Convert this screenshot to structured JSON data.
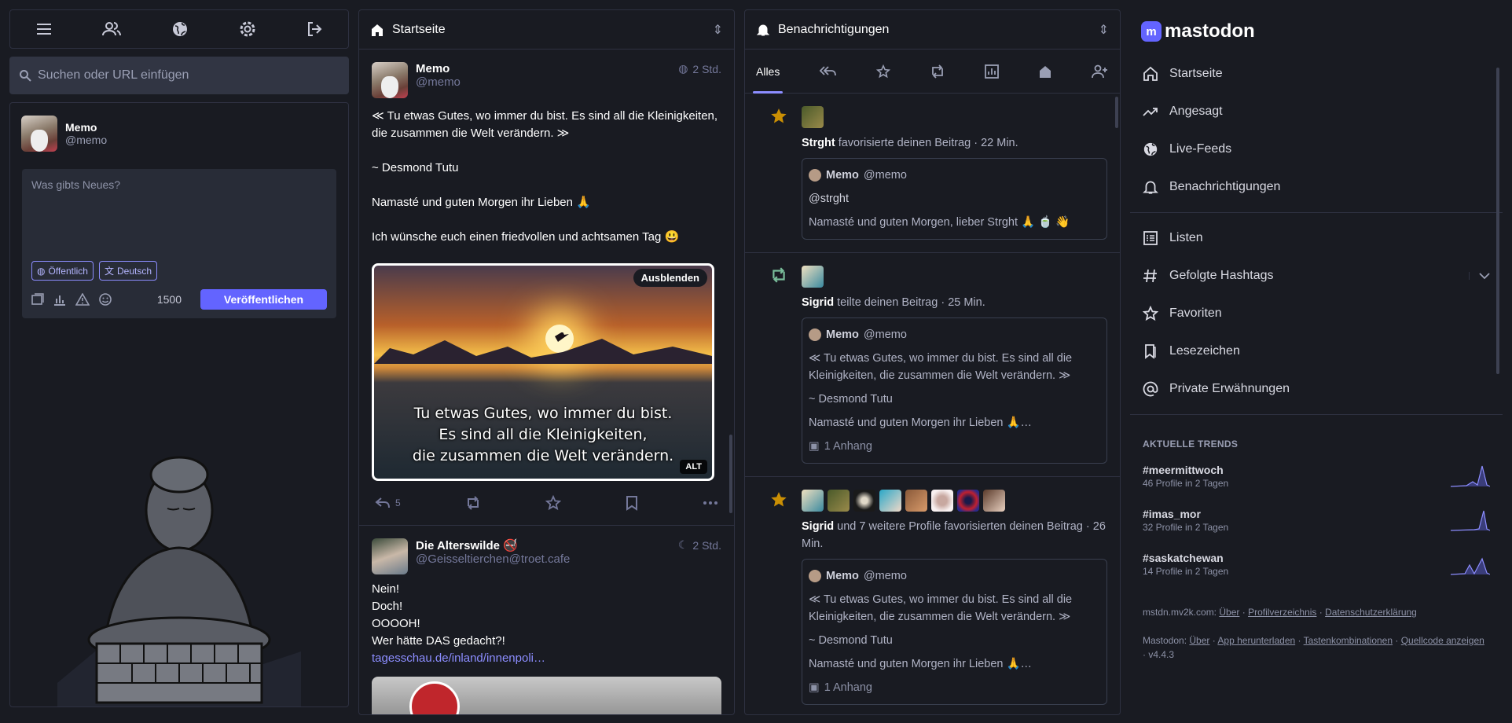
{
  "search": {
    "placeholder": "Suchen oder URL einfügen"
  },
  "me": {
    "name": "Memo",
    "handle": "@memo"
  },
  "compose": {
    "placeholder": "Was gibts Neues?",
    "visibility": "Öffentlich",
    "language": "Deutsch",
    "count": "1500",
    "publish": "Veröffentlichen"
  },
  "home": {
    "title": "Startseite",
    "post1": {
      "name": "Memo",
      "handle": "@memo",
      "time": "2 Std.",
      "p1": "≪ Tu etwas Gutes, wo immer du bist. Es sind all die Kleinigkeiten, die zusammen die Welt verändern. ≫",
      "p2": "~ Desmond Tutu",
      "p3": "Namasté und guten Morgen ihr Lieben 🙏",
      "p4": "Ich wünsche euch einen friedvollen und achtsamen Tag 😃",
      "img_line1": "Tu etwas Gutes, wo immer du bist.",
      "img_line2": "Es sind all die Kleinigkeiten,",
      "img_line3": "die zusammen die Welt verändern.",
      "hide": "Ausblenden",
      "alt": "ALT",
      "replies": "5"
    },
    "post2": {
      "name": "Die Alterswilde 🚭",
      "handle": "@Geisseltierchen@troet.cafe",
      "time": "2 Std.",
      "l1": "Nein!",
      "l2": "Doch!",
      "l3": "OOOOH!",
      "l4": "Wer hätte DAS gedacht?!",
      "link": "tagesschau.de/inland/innenpoli…"
    }
  },
  "notifs": {
    "title": "Benachrichtigungen",
    "tab_all": "Alles",
    "n1": {
      "who": "Strght",
      "action": "favorisierte deinen Beitrag",
      "time": "22 Min.",
      "qname": "Memo",
      "qhandle": "@memo",
      "q1": "@strght",
      "q2": "Namasté und guten Morgen, lieber Strght 🙏 🍵 👋"
    },
    "n2": {
      "who": "Sigrid",
      "action": "teilte deinen Beitrag",
      "time": "25 Min.",
      "qname": "Memo",
      "qhandle": "@memo",
      "q1": "≪ Tu etwas Gutes, wo immer du bist. Es sind all die Kleinigkeiten, die zusammen die Welt verändern. ≫",
      "q2": "~ Desmond Tutu",
      "q3": "Namasté und guten Morgen ihr Lieben 🙏…",
      "att": "1 Anhang"
    },
    "n3": {
      "who": "Sigrid",
      "action": "und 7 weitere Profile favorisierten deinen Beitrag",
      "time": "26 Min.",
      "qname": "Memo",
      "qhandle": "@memo",
      "q1": "≪ Tu etwas Gutes, wo immer du bist. Es sind all die Kleinigkeiten, die zusammen die Welt verändern. ≫",
      "q2": "~ Desmond Tutu",
      "q3": "Namasté und guten Morgen ihr Lieben 🙏…",
      "att": "1 Anhang"
    }
  },
  "side": {
    "logo": "mastodon",
    "nav": [
      "Startseite",
      "Angesagt",
      "Live-Feeds",
      "Benachrichtigungen",
      "Listen",
      "Gefolgte Hashtags",
      "Favoriten",
      "Lesezeichen",
      "Private Erwähnungen"
    ],
    "trends_title": "AKTUELLE TRENDS",
    "trends": [
      {
        "tag": "#meermittwoch",
        "meta": "46 Profile in 2 Tagen"
      },
      {
        "tag": "#imas_mor",
        "meta": "32 Profile in 2 Tagen"
      },
      {
        "tag": "#saskatchewan",
        "meta": "14 Profile in 2 Tagen"
      }
    ],
    "foot1_server": "mstdn.mv2k.com:",
    "foot1_links": [
      "Über",
      "Profilverzeichnis",
      "Datenschutzerklärung"
    ],
    "foot2_app": "Mastodon:",
    "foot2_links": [
      "Über",
      "App herunterladen",
      "Tastenkombinationen",
      "Quellcode anzeigen"
    ],
    "version": "v4.4.3"
  }
}
